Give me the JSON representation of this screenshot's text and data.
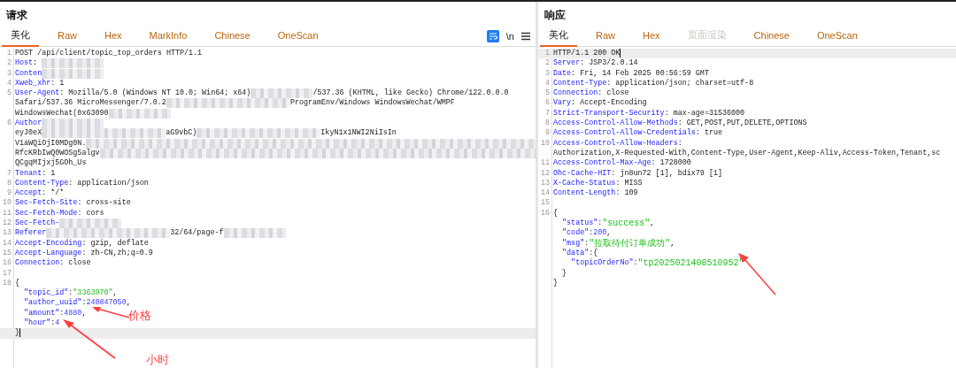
{
  "request": {
    "title": "请求",
    "tabs": [
      {
        "label": "美化",
        "selected": true,
        "disabled": false
      },
      {
        "label": "Raw",
        "selected": false,
        "disabled": false
      },
      {
        "label": "Hex",
        "selected": false,
        "disabled": false
      },
      {
        "label": "MarkInfo",
        "selected": false,
        "disabled": false
      },
      {
        "label": "Chinese",
        "selected": false,
        "disabled": false
      },
      {
        "label": "OneScan",
        "selected": false,
        "disabled": false
      }
    ],
    "toolbar": {
      "wrap_on": true,
      "newline_label": "\\n"
    },
    "lines": [
      {
        "n": "1",
        "current": false,
        "segs": [
          {
            "kind": "plain",
            "text": "POST /api/client/topic_top_orders HTTP/1.1"
          }
        ]
      },
      {
        "n": "2",
        "current": false,
        "segs": [
          {
            "kind": "key",
            "text": "Host"
          },
          {
            "kind": "plain",
            "text": ": "
          },
          {
            "kind": "blur"
          }
        ]
      },
      {
        "n": "3",
        "current": false,
        "segs": [
          {
            "kind": "key",
            "text": "Conten"
          },
          {
            "kind": "blur"
          }
        ]
      },
      {
        "n": "4",
        "current": false,
        "segs": [
          {
            "kind": "key",
            "text": "Xweb_xhr"
          },
          {
            "kind": "plain",
            "text": ": 1"
          }
        ]
      },
      {
        "n": "5",
        "current": false,
        "segs": [
          {
            "kind": "key",
            "text": "User-Agent"
          },
          {
            "kind": "plain",
            "text": ": Mozilla/5.0 (Windows NT 10.0; Win64; x64)"
          },
          {
            "kind": "blur"
          },
          {
            "kind": "plain",
            "text": "/537.36 (KHTML, like Gecko) Chrome/122.0.0.0"
          }
        ]
      },
      {
        "current": false,
        "segs": [
          {
            "kind": "plain",
            "text": "Safari/537.36 MicroMessenger/7.0.2"
          },
          {
            "kind": "blur-wide"
          },
          {
            "kind": "plain",
            "text": "ProgramEnv/Windows WindowsWechat/WMPF"
          }
        ]
      },
      {
        "current": false,
        "segs": [
          {
            "kind": "plain",
            "text": "WindowsWechat(0x63090"
          },
          {
            "kind": "blur"
          }
        ]
      },
      {
        "n": "6",
        "current": false,
        "segs": [
          {
            "kind": "key",
            "text": "Author"
          },
          {
            "kind": "blur"
          }
        ]
      },
      {
        "current": false,
        "segs": [
          {
            "kind": "plain",
            "text": "eyJ0eX"
          },
          {
            "kind": "blur-wide"
          },
          {
            "kind": "plain",
            "text": "aG9vbC)"
          },
          {
            "kind": "blur-wide"
          },
          {
            "kind": "plain",
            "text": "IkyN1x1NWI2NiIsIn"
          }
        ]
      },
      {
        "current": false,
        "segs": [
          {
            "kind": "plain",
            "text": "V1aWQiOjI0MDg0N."
          },
          {
            "kind": "blur-full"
          }
        ]
      },
      {
        "current": false,
        "segs": [
          {
            "kind": "plain",
            "text": "RfcKRbIwQ0WOSg5algv"
          },
          {
            "kind": "blur-full"
          }
        ]
      },
      {
        "current": false,
        "segs": [
          {
            "kind": "plain",
            "text": "QCgqMIjxj5GOh_Us"
          }
        ]
      },
      {
        "n": "7",
        "current": false,
        "segs": [
          {
            "kind": "key",
            "text": "Tenant"
          },
          {
            "kind": "plain",
            "text": ": 1"
          }
        ]
      },
      {
        "n": "8",
        "current": false,
        "segs": [
          {
            "kind": "key",
            "text": "Content-Type"
          },
          {
            "kind": "plain",
            "text": ": application/json"
          }
        ]
      },
      {
        "n": "9",
        "current": false,
        "segs": [
          {
            "kind": "key",
            "text": "Accept"
          },
          {
            "kind": "plain",
            "text": ": */*"
          }
        ]
      },
      {
        "n": "10",
        "current": false,
        "segs": [
          {
            "kind": "key",
            "text": "Sec-Fetch-Site"
          },
          {
            "kind": "plain",
            "text": ": cross-site"
          }
        ]
      },
      {
        "n": "11",
        "current": false,
        "segs": [
          {
            "kind": "key",
            "text": "Sec-Fetch-Mode"
          },
          {
            "kind": "plain",
            "text": ": cors"
          }
        ]
      },
      {
        "n": "12",
        "current": false,
        "segs": [
          {
            "kind": "key",
            "text": "Sec-Fetch-"
          },
          {
            "kind": "blur"
          }
        ]
      },
      {
        "n": "13",
        "current": false,
        "segs": [
          {
            "kind": "key",
            "text": "Referer"
          },
          {
            "kind": "blur-wide"
          },
          {
            "kind": "plain",
            "text": "32/64/page-f"
          },
          {
            "kind": "blur"
          }
        ]
      },
      {
        "n": "14",
        "current": false,
        "segs": [
          {
            "kind": "key",
            "text": "Accept-Encoding"
          },
          {
            "kind": "plain",
            "text": ": gzip, deflate"
          }
        ]
      },
      {
        "n": "15",
        "current": false,
        "segs": [
          {
            "kind": "key",
            "text": "Accept-Language"
          },
          {
            "kind": "plain",
            "text": ": zh-CN,zh;q=0.9"
          }
        ]
      },
      {
        "n": "16",
        "current": false,
        "segs": [
          {
            "kind": "key",
            "text": "Connection"
          },
          {
            "kind": "plain",
            "text": ": close"
          }
        ]
      },
      {
        "n": "17",
        "current": false
      },
      {
        "n": "18",
        "current": false,
        "segs": [
          {
            "kind": "plain",
            "text": "{"
          }
        ]
      },
      {
        "current": false,
        "segs": [
          {
            "kind": "key",
            "text": "  \"topic_id\""
          },
          {
            "kind": "plain",
            "text": ":"
          },
          {
            "kind": "string",
            "text": "\"3363970\""
          },
          {
            "kind": "plain",
            "text": ","
          }
        ]
      },
      {
        "current": false,
        "segs": [
          {
            "kind": "key",
            "text": "  \"author_uuid\""
          },
          {
            "kind": "plain",
            "text": ":"
          },
          {
            "kind": "number",
            "text": "240847050"
          },
          {
            "kind": "plain",
            "text": ","
          }
        ]
      },
      {
        "current": false,
        "segs": [
          {
            "kind": "key",
            "text": "  \"amount\""
          },
          {
            "kind": "plain",
            "text": ":"
          },
          {
            "kind": "number",
            "text": "4880"
          },
          {
            "kind": "plain",
            "text": ","
          }
        ]
      },
      {
        "current": false,
        "segs": [
          {
            "kind": "key",
            "text": "  \"hour\""
          },
          {
            "kind": "plain",
            "text": ":"
          },
          {
            "kind": "number",
            "text": "4"
          }
        ]
      },
      {
        "current": true,
        "segs": [
          {
            "kind": "plain",
            "text": "}"
          }
        ]
      }
    ],
    "annotations": [
      {
        "label": "价格"
      },
      {
        "label": "小时"
      }
    ]
  },
  "response": {
    "title": "响应",
    "tabs": [
      {
        "label": "美化",
        "selected": true,
        "disabled": false
      },
      {
        "label": "Raw",
        "selected": false,
        "disabled": false
      },
      {
        "label": "Hex",
        "selected": false,
        "disabled": false
      },
      {
        "label": "页面渲染",
        "selected": false,
        "disabled": true
      },
      {
        "label": "Chinese",
        "selected": false,
        "disabled": false
      },
      {
        "label": "OneScan",
        "selected": false,
        "disabled": false
      }
    ],
    "lines": [
      {
        "n": "1",
        "current": true,
        "segs": [
          {
            "kind": "plain",
            "text": "HTTP/1.1 200 OK"
          }
        ]
      },
      {
        "n": "2",
        "current": false,
        "segs": [
          {
            "kind": "key",
            "text": "Server"
          },
          {
            "kind": "plain",
            "text": ": JSP3/2.0.14"
          }
        ]
      },
      {
        "n": "3",
        "current": false,
        "segs": [
          {
            "kind": "key",
            "text": "Date"
          },
          {
            "kind": "plain",
            "text": ": Fri, 14 Feb 2025 00:56:59 GMT"
          }
        ]
      },
      {
        "n": "4",
        "current": false,
        "segs": [
          {
            "kind": "key",
            "text": "Content-Type"
          },
          {
            "kind": "plain",
            "text": ": application/json; charset=utf-8"
          }
        ]
      },
      {
        "n": "5",
        "current": false,
        "segs": [
          {
            "kind": "key",
            "text": "Connection"
          },
          {
            "kind": "plain",
            "text": ": close"
          }
        ]
      },
      {
        "n": "6",
        "current": false,
        "segs": [
          {
            "kind": "key",
            "text": "Vary"
          },
          {
            "kind": "plain",
            "text": ": Accept-Encoding"
          }
        ]
      },
      {
        "n": "7",
        "current": false,
        "segs": [
          {
            "kind": "key",
            "text": "Strict-Transport-Security"
          },
          {
            "kind": "plain",
            "text": ": max-age=31536000"
          }
        ]
      },
      {
        "n": "8",
        "current": false,
        "segs": [
          {
            "kind": "key",
            "text": "Access-Control-Allow-Methods"
          },
          {
            "kind": "plain",
            "text": ": GET,POST,PUT,DELETE,OPTIONS"
          }
        ]
      },
      {
        "n": "9",
        "current": false,
        "segs": [
          {
            "kind": "key",
            "text": "Access-Control-Allow-Credentials"
          },
          {
            "kind": "plain",
            "text": ": true"
          }
        ]
      },
      {
        "n": "10",
        "current": false,
        "segs": [
          {
            "kind": "key",
            "text": "Access-Control-Allow-Headers"
          },
          {
            "kind": "plain",
            "text": ":"
          }
        ]
      },
      {
        "current": false,
        "segs": [
          {
            "kind": "plain",
            "text": "Authorization,X-Requested-With,Content-Type,User-Agent,Keep-Aliv,Access-Token,Tenant,sc"
          }
        ]
      },
      {
        "n": "11",
        "current": false,
        "segs": [
          {
            "kind": "key",
            "text": "Access-Control-Max-Age"
          },
          {
            "kind": "plain",
            "text": ": 1728000"
          }
        ]
      },
      {
        "n": "12",
        "current": false,
        "segs": [
          {
            "kind": "key",
            "text": "Ohc-Cache-HIT"
          },
          {
            "kind": "plain",
            "text": ": jn8un72 [1], bdix79 [1]"
          }
        ]
      },
      {
        "n": "13",
        "current": false,
        "segs": [
          {
            "kind": "key",
            "text": "X-Cache-Status"
          },
          {
            "kind": "plain",
            "text": ": MISS"
          }
        ]
      },
      {
        "n": "14",
        "current": false,
        "segs": [
          {
            "kind": "key",
            "text": "Content-Length"
          },
          {
            "kind": "plain",
            "text": ": 109"
          }
        ]
      },
      {
        "n": "15",
        "current": false
      },
      {
        "n": "16",
        "current": false,
        "segs": [
          {
            "kind": "plain",
            "text": "{"
          }
        ]
      },
      {
        "current": false,
        "segs": [
          {
            "kind": "key",
            "text": "  \"status\""
          },
          {
            "kind": "plain",
            "text": ":"
          },
          {
            "kind": "string",
            "text": "\"success\""
          },
          {
            "kind": "plain",
            "text": ","
          }
        ]
      },
      {
        "current": false,
        "segs": [
          {
            "kind": "key",
            "text": "  \"code\""
          },
          {
            "kind": "plain",
            "text": ":"
          },
          {
            "kind": "number",
            "text": "200"
          },
          {
            "kind": "plain",
            "text": ","
          }
        ]
      },
      {
        "current": false,
        "segs": [
          {
            "kind": "key",
            "text": "  \"msg\""
          },
          {
            "kind": "plain",
            "text": ":"
          },
          {
            "kind": "string",
            "text": "\"拉取待付订单成功\""
          },
          {
            "kind": "plain",
            "text": ","
          }
        ]
      },
      {
        "current": false,
        "segs": [
          {
            "kind": "key",
            "text": "  \"data\""
          },
          {
            "kind": "plain",
            "text": ":{"
          }
        ]
      },
      {
        "current": false,
        "segs": [
          {
            "kind": "key",
            "text": "    \"topicOrderNo\""
          },
          {
            "kind": "plain",
            "text": ":"
          },
          {
            "kind": "string",
            "text": "\"tp2025021408510952\""
          }
        ]
      },
      {
        "current": false,
        "segs": [
          {
            "kind": "plain",
            "text": "  }"
          }
        ]
      },
      {
        "current": false,
        "segs": [
          {
            "kind": "plain",
            "text": "}"
          }
        ]
      }
    ]
  }
}
